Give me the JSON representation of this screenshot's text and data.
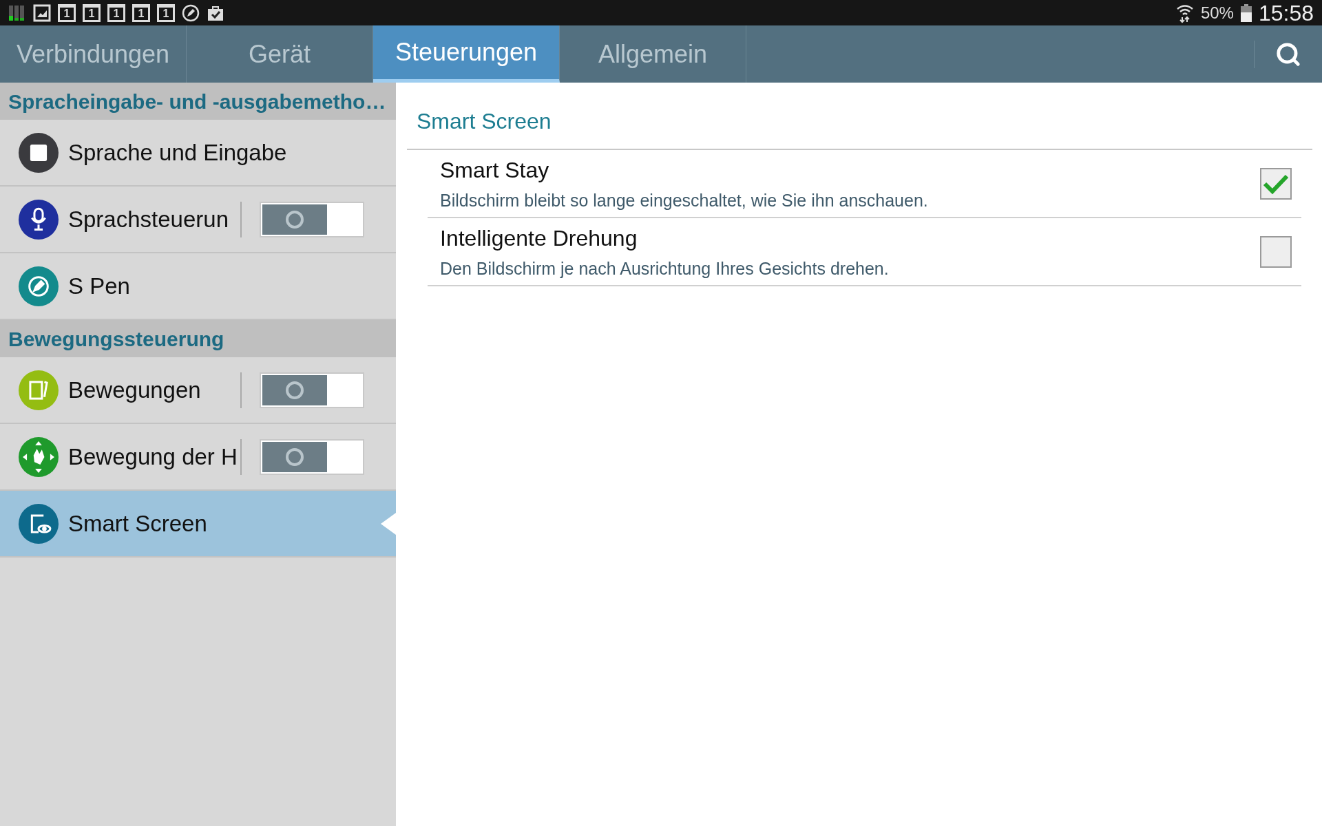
{
  "status_bar": {
    "notifications": [
      {
        "kind": "signal"
      },
      {
        "kind": "gallery"
      },
      {
        "kind": "calendar",
        "label": "1"
      },
      {
        "kind": "calendar",
        "label": "1"
      },
      {
        "kind": "calendar",
        "label": "1"
      },
      {
        "kind": "calendar",
        "label": "1"
      },
      {
        "kind": "calendar",
        "label": "1"
      },
      {
        "kind": "pen"
      },
      {
        "kind": "bag"
      }
    ],
    "battery_text": "50%",
    "time": "15:58"
  },
  "tabs": [
    {
      "label": "Verbindungen",
      "selected": false
    },
    {
      "label": "Gerät",
      "selected": false
    },
    {
      "label": "Steuerungen",
      "selected": true
    },
    {
      "label": "Allgemein",
      "selected": false
    }
  ],
  "sidebar": {
    "items": [
      {
        "kind": "header",
        "label": "Spracheingabe- und -ausgabemetho…"
      },
      {
        "kind": "item",
        "label": "Sprache und Eingabe",
        "color": "#3a3a3e",
        "selected": false
      },
      {
        "kind": "toggle",
        "label": "Sprachsteuerun",
        "color": "#1f2f9e",
        "selected": false,
        "on": false
      },
      {
        "kind": "item",
        "label": "S Pen",
        "color": "#138a8c",
        "selected": false
      },
      {
        "kind": "header",
        "label": "Bewegungssteuerung"
      },
      {
        "kind": "toggle",
        "label": "Bewegungen",
        "color": "#94bd12",
        "selected": false,
        "on": false
      },
      {
        "kind": "toggle",
        "label": "Bewegung der H",
        "color": "#1f9a2c",
        "selected": false,
        "on": false
      },
      {
        "kind": "item",
        "label": "Smart Screen",
        "color": "#0d6a8c",
        "selected": true
      }
    ]
  },
  "content": {
    "title": "Smart Screen",
    "options": [
      {
        "title": "Smart Stay",
        "description": "Bildschirm bleibt so lange eingeschaltet, wie Sie ihn anschauen.",
        "checked": true
      },
      {
        "title": "Intelligente Drehung",
        "description": "Den Bildschirm je nach Ausrichtung Ihres Gesichts drehen.",
        "checked": false
      }
    ]
  }
}
